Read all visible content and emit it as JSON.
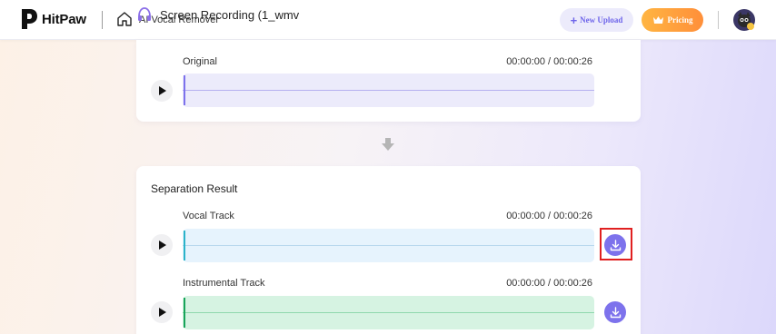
{
  "header": {
    "logo_text": "HitPaw",
    "tool_name": "AI Vocal Remover",
    "overlay_title": "Screen Recording (1_wmv",
    "new_upload_label": "New Upload",
    "pricing_label": "Pricing"
  },
  "original": {
    "label": "Original",
    "time": "00:00:00 / 00:00:26"
  },
  "result": {
    "title": "Separation Result",
    "tracks": [
      {
        "label": "Vocal Track",
        "time": "00:00:00 / 00:00:26"
      },
      {
        "label": "Instrumental Track",
        "time": "00:00:00 / 00:00:26"
      }
    ]
  },
  "colors": {
    "accent": "#7d72ec",
    "pricing": "#ff9e3d",
    "original_wave": "#ecebfb",
    "vocal_wave": "#e6f3fd",
    "instrumental_wave": "#d6f3e2",
    "highlight": "#e02020"
  },
  "icons": {
    "logo": "hitpaw-logo-icon",
    "home": "home-icon",
    "headphones": "headphones-icon",
    "crown": "crown-icon",
    "play": "play-icon",
    "download": "download-icon",
    "arrow": "arrow-down-icon"
  }
}
